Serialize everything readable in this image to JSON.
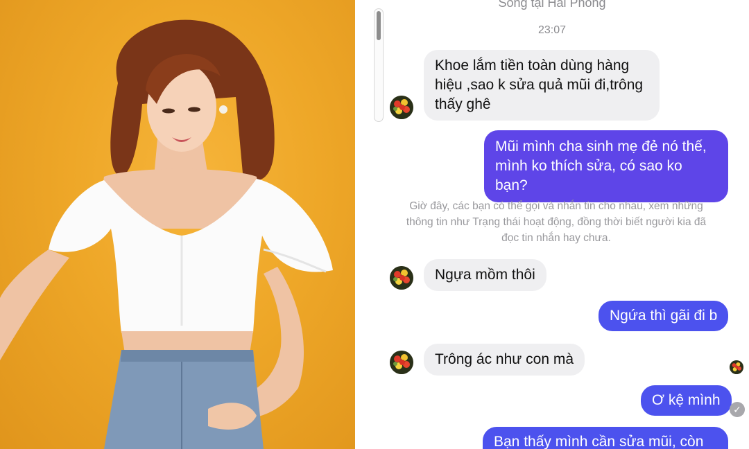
{
  "header": {
    "location": "Sống tại Hải Phòng"
  },
  "timestamp": "23:07",
  "messages": [
    {
      "side": "in",
      "lines": [
        "Khoe lắm tiền toàn dùng hàng",
        "hiệu ,sao k sửa quả mũi đi,trông",
        "thấy ghê"
      ]
    },
    {
      "side": "out",
      "lines": [
        "Mũi mình cha sinh mẹ đẻ nó thế,",
        "mình ko thích sửa, có sao ko bạn?"
      ]
    },
    {
      "side": "in",
      "lines": [
        "Ngựa mồm thôi"
      ]
    },
    {
      "side": "out",
      "lines": [
        "Ngứa thì gãi đi b"
      ]
    },
    {
      "side": "in",
      "lines": [
        "Trông ác như con mà"
      ]
    },
    {
      "side": "out",
      "lines": [
        "Ơ kệ mình"
      ]
    },
    {
      "side": "out",
      "lines": [
        "Bạn thấy mình cần sửa mũi, còn"
      ]
    }
  ],
  "system_note": {
    "lines": [
      "Giờ đây, các bạn có thể gọi và nhắn tin cho nhau, xem những",
      "thông tin như Trạng thái hoạt động, đồng thời biết người kia đã",
      "đọc tin nhắn hay chưa."
    ]
  },
  "icons": {
    "avatar": "flower-bouquet-avatar-icon",
    "seen": "checkmark-seen-icon",
    "seen_glyph": "✓"
  },
  "colors": {
    "incoming_bubble": "#efeff1",
    "outgoing_bubble": "#4c52ee",
    "outgoing_bubble_alt": "#5e45e8",
    "photo_background": "#eea728"
  }
}
